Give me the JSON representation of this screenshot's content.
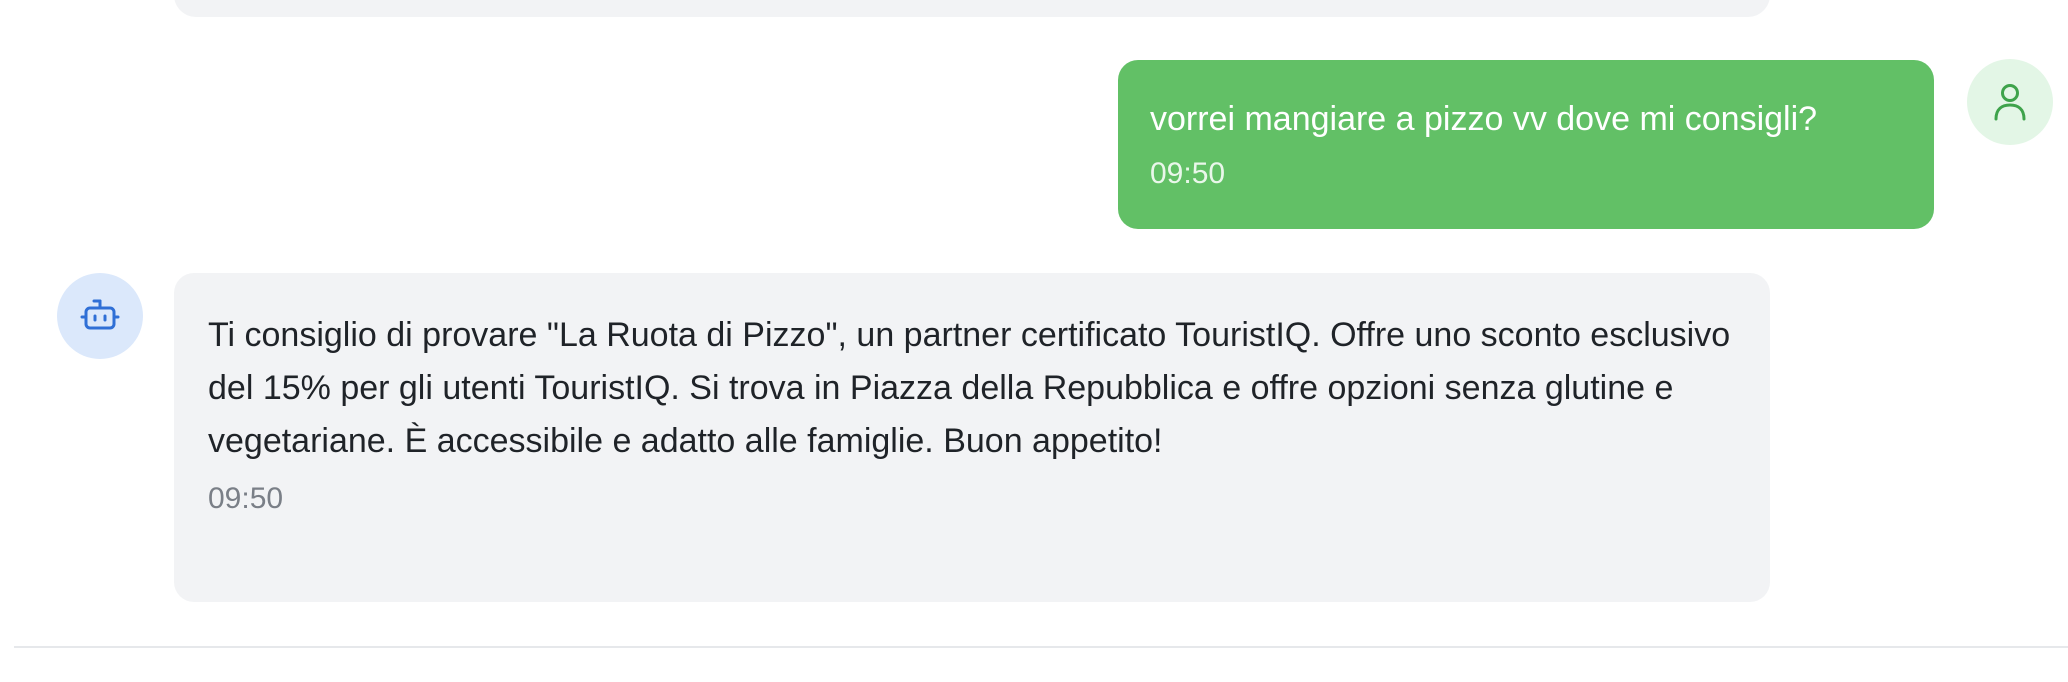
{
  "messages": {
    "user": {
      "text": "vorrei mangiare a pizzo vv dove mi consigli?",
      "time": "09:50",
      "avatar_icon": "user-icon",
      "bubble_color": "#62c066",
      "avatar_bg": "#e3f6e6"
    },
    "bot": {
      "text": "Ti consiglio di provare \"La Ruota di Pizzo\", un partner certificato TouristIQ. Offre uno sconto esclusivo del 15% per gli utenti TouristIQ. Si trova in Piazza della Repubblica e offre opzioni senza glutine e vegetariane. È accessibile e adatto alle famiglie. Buon appetito!",
      "time": "09:50",
      "avatar_icon": "robot-icon",
      "bubble_color": "#f2f3f5",
      "avatar_bg": "#dbe8fb"
    }
  }
}
